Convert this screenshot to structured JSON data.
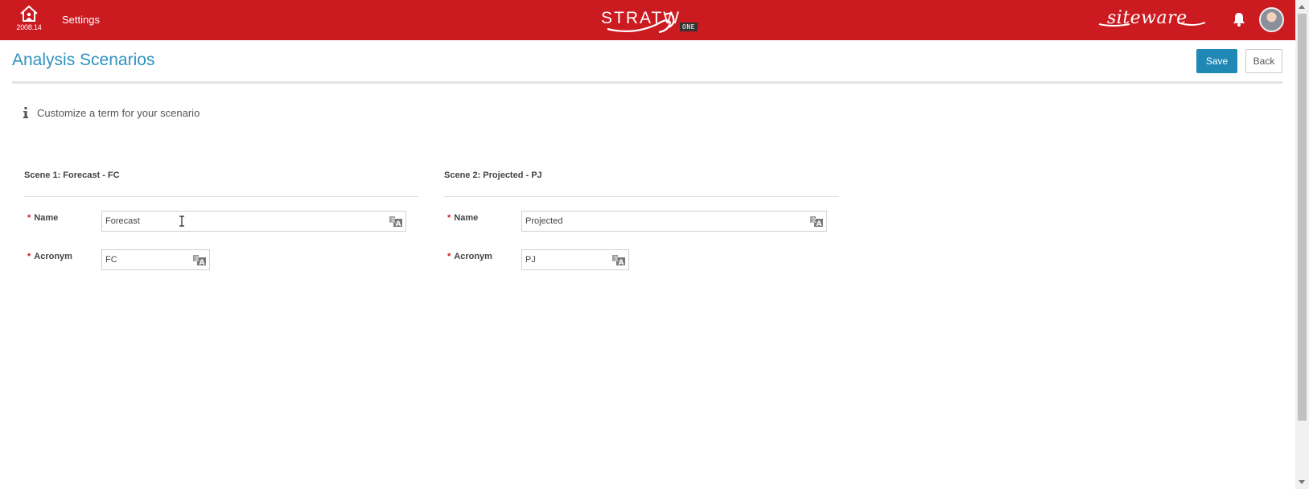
{
  "topbar": {
    "version": "2008.14",
    "settings_label": "Settings",
    "logo_word": "STRATW",
    "logo_badge": "ONE",
    "brand_right": "sitewa",
    "brand_right_suffix": "re",
    "accent_color": "#cc1a21",
    "icons": [
      "home-icon",
      "bell-icon",
      "avatar"
    ]
  },
  "page": {
    "title": "Analysis Scenarios",
    "save_label": "Save",
    "back_label": "Back",
    "info_text": "Customize a term for your scenario",
    "title_color": "#2f93c0",
    "primary_button_color": "#1f88b5"
  },
  "scenes": [
    {
      "title": "Scene 1: Forecast - FC",
      "name_label": "Name",
      "name_value": "Forecast",
      "acronym_label": "Acronym",
      "acronym_value": "FC"
    },
    {
      "title": "Scene 2: Projected - PJ",
      "name_label": "Name",
      "name_value": "Projected",
      "acronym_label": "Acronym",
      "acronym_value": "PJ"
    }
  ],
  "required_marker": "*"
}
